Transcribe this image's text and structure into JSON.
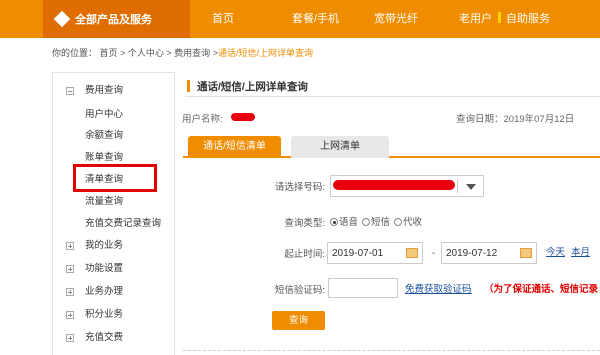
{
  "topnav": {
    "all_products": "全部产品及服务",
    "items": [
      "首页",
      "套餐/手机",
      "宽带光纤",
      "老用户"
    ],
    "self_service": "自助服务"
  },
  "breadcrumb": {
    "prefix": "你的位置：",
    "path": [
      "首页",
      "个人中心",
      "费用查询"
    ],
    "current": "通话/短信/上网详单查询",
    "separator": ">"
  },
  "sidebar": {
    "groups": [
      {
        "label": "费用查询",
        "expanded": true,
        "children": [
          "用户中心",
          "余额查询",
          "账单查询",
          "清单查询",
          "流量查询",
          "充值交费记录查询"
        ]
      },
      {
        "label": "我的业务",
        "expanded": false
      },
      {
        "label": "功能设置",
        "expanded": false
      },
      {
        "label": "业务办理",
        "expanded": false
      },
      {
        "label": "积分业务",
        "expanded": false
      },
      {
        "label": "充值交费",
        "expanded": false
      }
    ]
  },
  "main": {
    "title": "通话/短信/上网详单查询",
    "username_label": "用户名称:",
    "query_date": "查询日期：2019年07月12日",
    "tabs": [
      {
        "label": "通话/短信清单",
        "active": true
      },
      {
        "label": "上网清单",
        "active": false
      }
    ],
    "form": {
      "number_label": "请选择号码:",
      "type_label": "查询类型:",
      "type_options": [
        {
          "label": "语音",
          "selected": true
        },
        {
          "label": "短信",
          "selected": false
        },
        {
          "label": "代收",
          "selected": false
        }
      ],
      "time_label": "起止时间:",
      "start_date": "2019-07-01",
      "end_date": "2019-07-12",
      "date_dash": "-",
      "quick_links": [
        "今天",
        "本月"
      ],
      "sms_code_label": "短信验证码:",
      "get_code_link": "免费获取验证码",
      "warning": "（为了保证通话、短信记录",
      "query_button": "查询"
    }
  },
  "colors": {
    "accent": "#f08c00",
    "accent_dark": "#e06d00",
    "highlight_box": "#e30000",
    "link": "#1a4f9c"
  }
}
